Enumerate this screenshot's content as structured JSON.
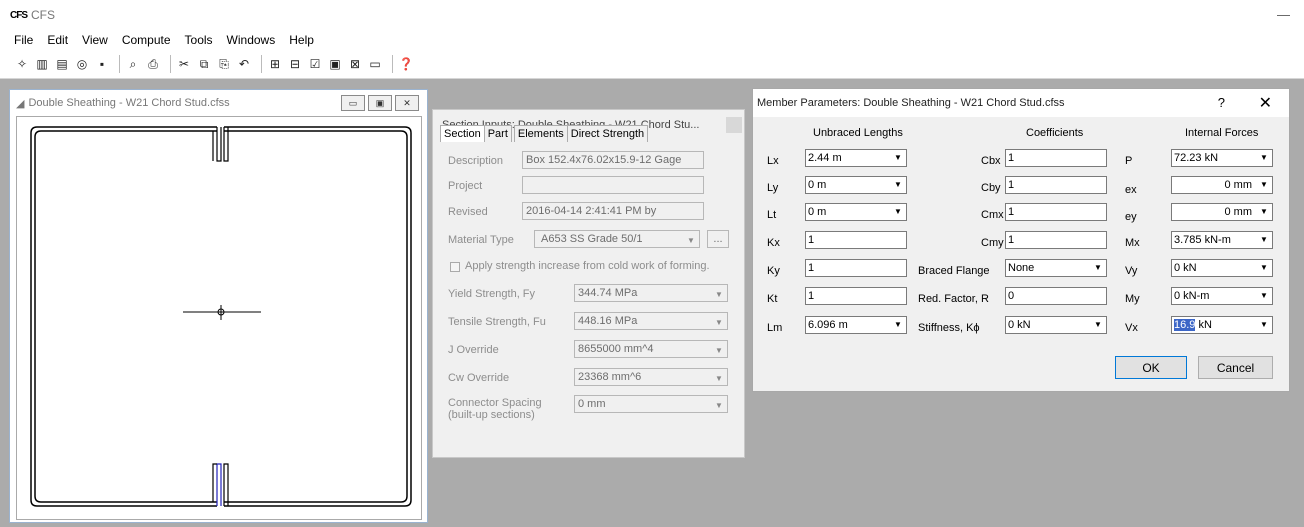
{
  "app": {
    "logo": "CFS",
    "title": "CFS",
    "minimize": "—"
  },
  "menu": [
    "File",
    "Edit",
    "View",
    "Compute",
    "Tools",
    "Windows",
    "Help"
  ],
  "toolbar_icons": [
    "new-icon",
    "import-icon",
    "open-icon",
    "export-icon",
    "save-icon",
    "print-preview-icon",
    "print-icon",
    "cut-icon",
    "copy-icon",
    "paste-icon",
    "undo-icon",
    "section-icon",
    "member-icon",
    "check-icon",
    "report-icon",
    "graph-icon",
    "window-icon",
    "help-icon"
  ],
  "section_window": {
    "title": "Double Sheathing - W21 Chord Stud.cfss",
    "btn_min": "▭",
    "btn_max": "▣",
    "btn_close": "✕"
  },
  "inputs_window": {
    "title": "Section Inputs: Double Sheathing - W21 Chord Stu...",
    "tabs": [
      "Section",
      "Part",
      "Elements",
      "Direct Strength"
    ],
    "description_label": "Description",
    "description_value": "Box 152.4x76.02x15.9-12 Gage",
    "project_label": "Project",
    "project_value": "",
    "revised_label": "Revised",
    "revised_value": "2016-04-14 2:41:41 PM by",
    "material_label": "Material Type",
    "material_value": "A653 SS Grade 50/1",
    "material_btn": "...",
    "cold_work_label": "Apply strength increase from cold work of forming.",
    "fy_label": "Yield Strength, Fy",
    "fy_value": "344.74 MPa",
    "fu_label": "Tensile Strength, Fu",
    "fu_value": "448.16 MPa",
    "j_label": "J Override",
    "j_value": "8655000 mm^4",
    "cw_label": "Cw Override",
    "cw_value": "23368 mm^6",
    "conn_label1": "Connector Spacing",
    "conn_label2": "(built-up sections)",
    "conn_value": "0 mm"
  },
  "member_window": {
    "title": "Member Parameters: Double Sheathing - W21 Chord Stud.cfss",
    "help": "?",
    "close": "✕",
    "h_unbraced": "Unbraced Lengths",
    "h_coeff": "Coefficients",
    "h_forces": "Internal Forces",
    "Lx_label": "Lx",
    "Lx": "2.44 m",
    "Ly_label": "Ly",
    "Ly": "0 m",
    "Lt_label": "Lt",
    "Lt": "0 m",
    "Kx_label": "Kx",
    "Kx": "1",
    "Ky_label": "Ky",
    "Ky": "1",
    "Kt_label": "Kt",
    "Kt": "1",
    "Lm_label": "Lm",
    "Lm": "6.096 m",
    "Cbx_label": "Cbx",
    "Cbx": "1",
    "Cby_label": "Cby",
    "Cby": "1",
    "Cmx_label": "Cmx",
    "Cmx": "1",
    "Cmy_label": "Cmy",
    "Cmy": "1",
    "braced_label": "Braced Flange",
    "braced": "None",
    "red_label": "Red. Factor, R",
    "red": "0",
    "stiff_label": "Stiffness,  Kϕ",
    "stiff": "0 kN",
    "P_label": "P",
    "P": "72.23 kN",
    "ex_label": "ex",
    "ex": "0 mm",
    "ey_label": "ey",
    "ey": "0 mm",
    "Mx_label": "Mx",
    "Mx": "3.785 kN-m",
    "Vy_label": "Vy",
    "Vy": "0 kN",
    "My_label": "My",
    "My": "0 kN-m",
    "Vx_label": "Vx",
    "Vx_sel": "16.9",
    "Vx_unit": " kN",
    "ok": "OK",
    "cancel": "Cancel"
  }
}
